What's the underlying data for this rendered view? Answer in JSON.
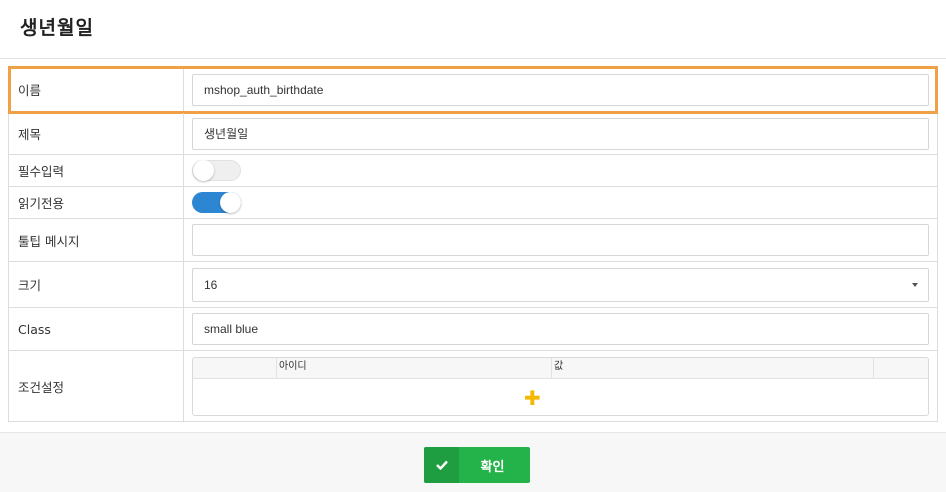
{
  "dialog": {
    "title": "생년월일"
  },
  "fields": {
    "name": {
      "label": "이름",
      "value": "mshop_auth_birthdate"
    },
    "subject": {
      "label": "제목",
      "value": "생년월일"
    },
    "required": {
      "label": "필수입력",
      "on": false
    },
    "readonly": {
      "label": "읽기전용",
      "on": true
    },
    "tooltip": {
      "label": "툴팁 메시지",
      "value": ""
    },
    "size": {
      "label": "크기",
      "value": "16"
    },
    "class": {
      "label": "Class",
      "value": "small blue"
    },
    "conditions": {
      "label": "조건설정",
      "columns": [
        "아이디",
        "값"
      ]
    }
  },
  "footer": {
    "confirm_label": "확인"
  },
  "colors": {
    "accent_highlight": "#f0a046",
    "toggle_on": "#2d86d1",
    "confirm": "#24b24b",
    "add": "#f5b800"
  },
  "icons": {
    "add": "plus-icon",
    "confirm": "check-icon",
    "dropdown": "caret-down-icon"
  }
}
